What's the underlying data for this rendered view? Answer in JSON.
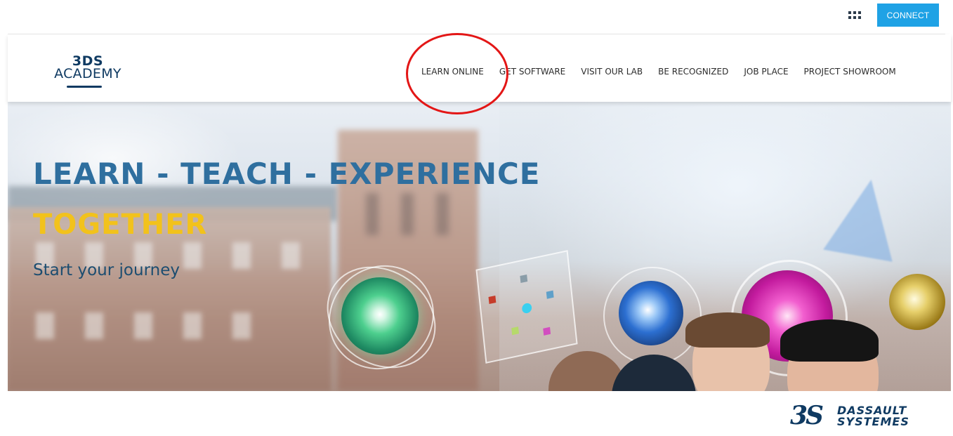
{
  "topbar": {
    "apps_icon": "apps-grid-icon",
    "connect_label": "CONNECT",
    "connect_color": "#1fa2e5"
  },
  "header": {
    "logo_top": "3DS",
    "logo_bottom": "ACADEMY",
    "nav": [
      {
        "label": "LEARN ONLINE"
      },
      {
        "label": "GET SOFTWARE"
      },
      {
        "label": "VISIT OUR LAB"
      },
      {
        "label": "BE RECOGNIZED"
      },
      {
        "label": "JOB PLACE"
      },
      {
        "label": "PROJECT SHOWROOM"
      }
    ]
  },
  "hero": {
    "title_line1": "LEARN - TEACH - EXPERIENCE",
    "title_line2": "TOGETHER",
    "subtitle": "Start your journey",
    "title_color": "#2f6f9f",
    "accent_color": "#f2c21b"
  },
  "footer": {
    "brand_mark": "3S",
    "brand_line1": "DASSAULT",
    "brand_line2": "SYSTEMES"
  }
}
